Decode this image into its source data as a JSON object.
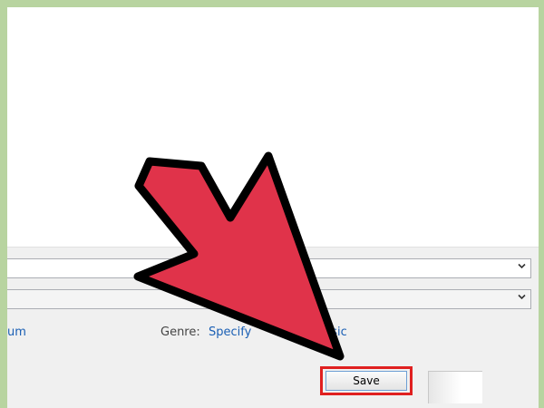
{
  "metadata": {
    "album_link": "um",
    "genre_label": "Genre:",
    "genre_value": "Specify",
    "genre_value_tail": "usic"
  },
  "actions": {
    "save_label": "Save"
  },
  "annotation": {
    "arrow_color": "#e0334a",
    "highlight_color": "#e02020"
  }
}
